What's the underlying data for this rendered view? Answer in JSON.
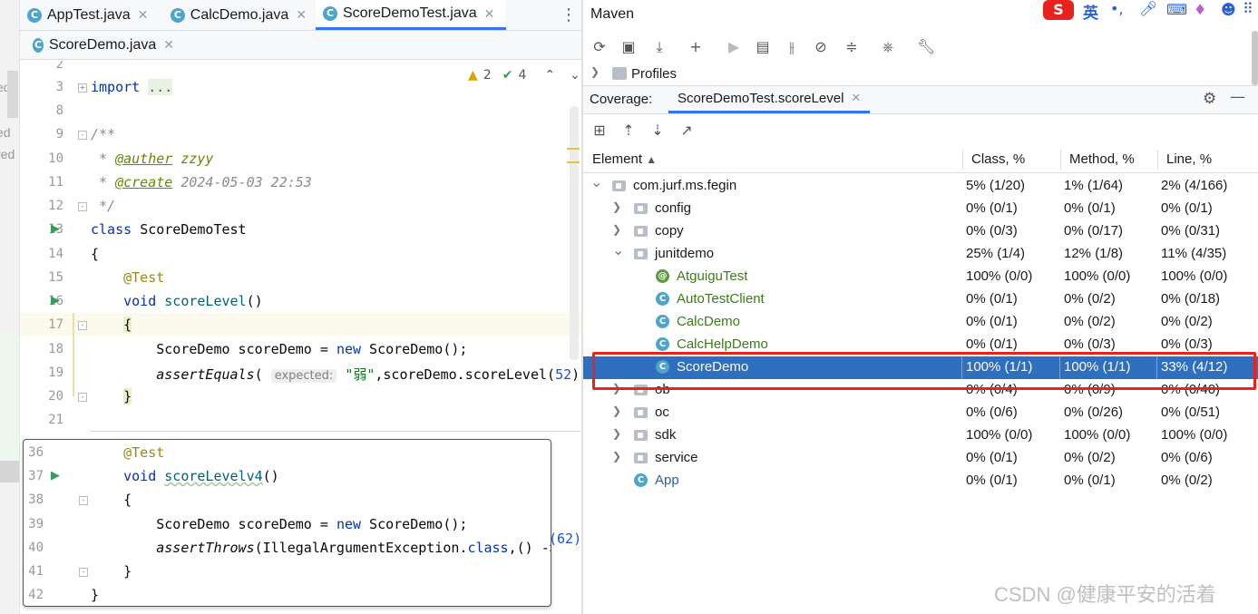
{
  "left_strip": [
    "ed",
    "ed",
    "red"
  ],
  "tabs_row1": [
    {
      "label": "AppTest.java",
      "active": false
    },
    {
      "label": "CalcDemo.java",
      "active": false
    },
    {
      "label": "ScoreDemoTest.java",
      "active": true
    }
  ],
  "tabs_row2": [
    {
      "label": "ScoreDemo.java"
    }
  ],
  "inspection": {
    "warnings": "2",
    "checks": "4"
  },
  "editor_lines": [
    {
      "num": "2"
    },
    {
      "num": "3"
    },
    {
      "num": "8"
    },
    {
      "num": "9"
    },
    {
      "num": "10"
    },
    {
      "num": "11"
    },
    {
      "num": "12"
    },
    {
      "num": "13"
    },
    {
      "num": "14"
    },
    {
      "num": "15"
    },
    {
      "num": "16"
    },
    {
      "num": "17"
    },
    {
      "num": "18"
    },
    {
      "num": "19"
    },
    {
      "num": "20"
    },
    {
      "num": "21"
    }
  ],
  "code": {
    "import_kw": "import",
    "import_fold": "...",
    "javadoc_open": "/**",
    "tag_author": "@auther",
    "author": "zzyy",
    "tag_create": "@create",
    "create_date": "2024-05-03 22:53",
    "javadoc_close": "*/",
    "class_kw": "class",
    "class_name": "ScoreDemoTest",
    "brace_open": "{",
    "test_ann": "@Test",
    "void_kw": "void",
    "method1": "scoreLevel",
    "parens": "()",
    "brace_inner_open": "{",
    "stmt_type": "ScoreDemo scoreDemo = ",
    "new_kw": "new",
    "stmt_ctor": " ScoreDemo();",
    "assert_fn": "assertEquals",
    "hint_expected": "expected:",
    "assert_str": "\"弱\"",
    "assert_rest": ",scoreDemo.scoreLevel(",
    "assert_num": "52",
    "assert_close": ")",
    "brace_inner_close": "}"
  },
  "popup_lines": [
    {
      "num": "36"
    },
    {
      "num": "37"
    },
    {
      "num": "38"
    },
    {
      "num": "39"
    },
    {
      "num": "40"
    },
    {
      "num": "41"
    },
    {
      "num": "42"
    }
  ],
  "popup_code": {
    "test_ann": "@Test",
    "void_kw": "void",
    "method2": "scoreLevelv4",
    "parens": "()",
    "brace_open": "{",
    "stmt_type": "ScoreDemo scoreDemo = ",
    "new_kw": "new",
    "stmt_ctor": " ScoreDemo();",
    "throws_fn": "assertThrows",
    "throws_rest": "(IllegalArgumentException.",
    "class_kw": "class",
    "throws_lambda": ",() ->",
    "brace_close": "}",
    "outer_close": "}"
  },
  "behind_popup_num": "(62)",
  "maven": {
    "title": "Maven",
    "profiles": "Profiles"
  },
  "coverage": {
    "label": "Coverage:",
    "tab": "ScoreDemoTest.scoreLevel"
  },
  "table": {
    "headers": [
      "Element",
      "Class, %",
      "Method, %",
      "Line, %"
    ],
    "rows": [
      {
        "indent": 0,
        "arrow": "open",
        "icon": "package",
        "name": "com.jurf.ms.fegin",
        "cls": "5% (1/20)",
        "method": "1% (1/64)",
        "line": "2% (4/166)",
        "color": "normal"
      },
      {
        "indent": 1,
        "arrow": "closed",
        "icon": "package",
        "name": "config",
        "cls": "0% (0/1)",
        "method": "0% (0/1)",
        "line": "0% (0/1)",
        "color": "normal"
      },
      {
        "indent": 1,
        "arrow": "closed",
        "icon": "package",
        "name": "copy",
        "cls": "0% (0/3)",
        "method": "0% (0/17)",
        "line": "0% (0/31)",
        "color": "normal"
      },
      {
        "indent": 1,
        "arrow": "open",
        "icon": "package",
        "name": "junitdemo",
        "cls": "25% (1/4)",
        "method": "12% (1/8)",
        "line": "11% (4/35)",
        "color": "normal"
      },
      {
        "indent": 2,
        "arrow": "none",
        "icon": "annotation",
        "name": "AtguiguTest",
        "cls": "100% (0/0)",
        "method": "100% (0/0)",
        "line": "100% (0/0)",
        "color": "green"
      },
      {
        "indent": 2,
        "arrow": "none",
        "icon": "class",
        "name": "AutoTestClient",
        "cls": "0% (0/1)",
        "method": "0% (0/2)",
        "line": "0% (0/18)",
        "color": "green"
      },
      {
        "indent": 2,
        "arrow": "none",
        "icon": "class",
        "name": "CalcDemo",
        "cls": "0% (0/1)",
        "method": "0% (0/2)",
        "line": "0% (0/2)",
        "color": "green"
      },
      {
        "indent": 2,
        "arrow": "none",
        "icon": "class",
        "name": "CalcHelpDemo",
        "cls": "0% (0/1)",
        "method": "0% (0/3)",
        "line": "0% (0/3)",
        "color": "green"
      },
      {
        "indent": 2,
        "arrow": "none",
        "icon": "class",
        "name": "ScoreDemo",
        "cls": "100% (1/1)",
        "method": "100% (1/1)",
        "line": "33% (4/12)",
        "color": "selected"
      },
      {
        "indent": 1,
        "arrow": "closed",
        "icon": "package",
        "name": "ob",
        "cls": "0% (0/4)",
        "method": "0% (0/9)",
        "line": "0% (0/40)",
        "color": "normal"
      },
      {
        "indent": 1,
        "arrow": "closed",
        "icon": "package",
        "name": "oc",
        "cls": "0% (0/6)",
        "method": "0% (0/26)",
        "line": "0% (0/51)",
        "color": "normal"
      },
      {
        "indent": 1,
        "arrow": "closed",
        "icon": "package",
        "name": "sdk",
        "cls": "100% (0/0)",
        "method": "100% (0/0)",
        "line": "100% (0/0)",
        "color": "normal"
      },
      {
        "indent": 1,
        "arrow": "closed",
        "icon": "package",
        "name": "service",
        "cls": "0% (0/1)",
        "method": "0% (0/2)",
        "line": "0% (0/6)",
        "color": "normal"
      },
      {
        "indent": 1,
        "arrow": "none",
        "icon": "class",
        "name": "App",
        "cls": "0% (0/1)",
        "method": "0% (0/1)",
        "line": "0% (0/2)",
        "color": "blue"
      }
    ]
  },
  "ime_label": "英",
  "watermark": "CSDN @健康平安的活着",
  "colors": {
    "accent": "#3574f0",
    "selected_row": "#2f6fbf",
    "highlight_box": "#e8221c"
  }
}
